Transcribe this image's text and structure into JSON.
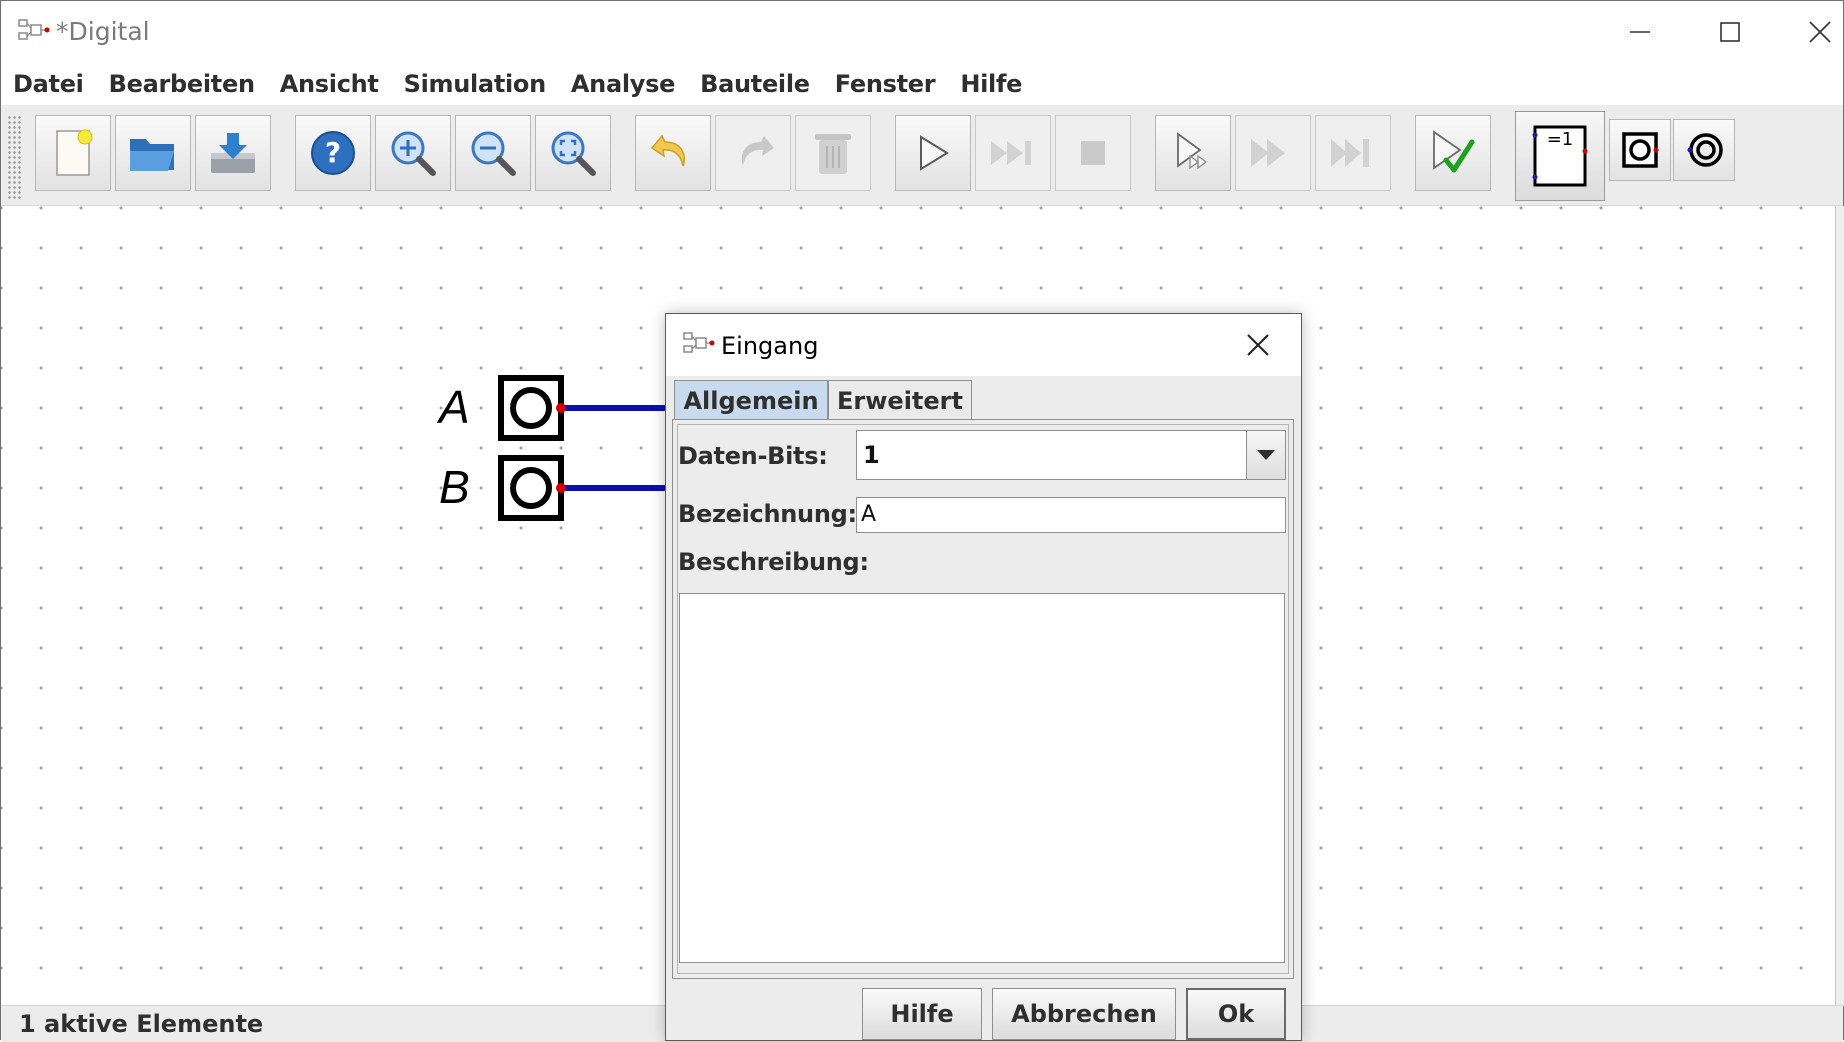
{
  "window": {
    "title": "*Digital",
    "controls": [
      "minimize-icon",
      "maximize-icon",
      "close-icon"
    ]
  },
  "menu": [
    "Datei",
    "Bearbeiten",
    "Ansicht",
    "Simulation",
    "Analyse",
    "Bauteile",
    "Fenster",
    "Hilfe"
  ],
  "toolbar": {
    "buttons": [
      {
        "icon": "new-file-icon",
        "enabled": true
      },
      {
        "icon": "open-folder-icon",
        "enabled": true
      },
      {
        "icon": "save-icon",
        "enabled": true
      },
      {
        "icon": "help-icon",
        "enabled": true
      },
      {
        "icon": "zoom-in-icon",
        "enabled": true
      },
      {
        "icon": "zoom-out-icon",
        "enabled": true
      },
      {
        "icon": "zoom-fit-icon",
        "enabled": true
      },
      {
        "icon": "undo-icon",
        "enabled": true
      },
      {
        "icon": "redo-icon",
        "enabled": false
      },
      {
        "icon": "delete-icon",
        "enabled": false
      },
      {
        "icon": "play-icon",
        "enabled": true
      },
      {
        "icon": "step-forward-icon",
        "enabled": false
      },
      {
        "icon": "stop-icon",
        "enabled": false
      },
      {
        "icon": "micro-step-icon",
        "enabled": true
      },
      {
        "icon": "fast-forward-icon",
        "enabled": false
      },
      {
        "icon": "run-to-break-icon",
        "enabled": false
      },
      {
        "icon": "test-check-icon",
        "enabled": true
      },
      {
        "icon": "xor-gate-icon",
        "enabled": true,
        "label": "=1"
      },
      {
        "icon": "input-component-icon",
        "enabled": true
      },
      {
        "icon": "output-component-icon",
        "enabled": true
      }
    ]
  },
  "canvas": {
    "inputs": [
      {
        "label": "A"
      },
      {
        "label": "B"
      }
    ],
    "wire_color": "#0a10b0",
    "pin_color": "#d00000"
  },
  "status": "1 aktive Elemente",
  "dialog": {
    "title": "Eingang",
    "tabs": [
      "Allgemein",
      "Erweitert"
    ],
    "active_tab": "Allgemein",
    "fields": {
      "data_bits_label": "Daten-Bits:",
      "data_bits_value": "1",
      "name_label": "Bezeichnung:",
      "name_value": "A",
      "description_label": "Beschreibung:",
      "description_value": ""
    },
    "buttons": {
      "help": "Hilfe",
      "cancel": "Abbrechen",
      "ok": "Ok"
    },
    "tab_active_color": "#c8dbee"
  }
}
